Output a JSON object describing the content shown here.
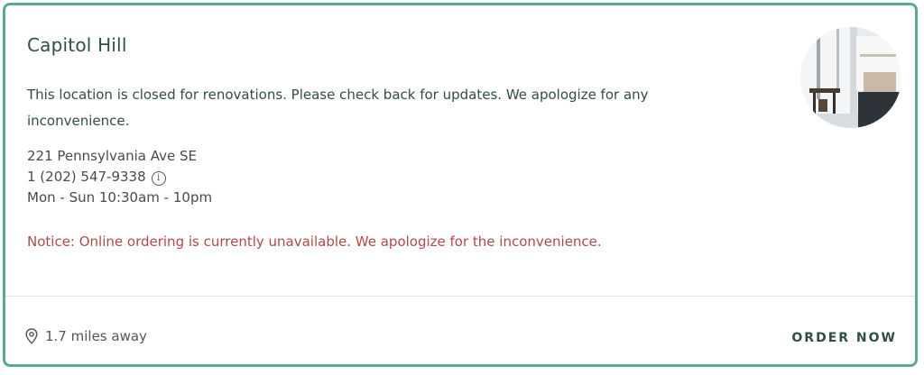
{
  "location": {
    "name": "Capitol Hill",
    "message": "This location is closed for renovations. Please check back for updates. We apologize for any inconvenience.",
    "address": "221 Pennsylvania Ave SE",
    "phone": "1 (202) 547-9338",
    "hours": "Mon - Sun 10:30am - 10pm",
    "notice": "Notice: Online ordering is currently unavailable. We apologize for the inconvenience.",
    "distance": "1.7 miles away",
    "photo_icon": "restaurant-interior-photo"
  },
  "footer": {
    "order_label": "ORDER NOW"
  },
  "colors": {
    "border": "#5aab8e",
    "title": "#2f4f46",
    "notice": "#b04a46",
    "text": "#4a4a4a"
  },
  "icons": {
    "info": "info-icon",
    "location": "location-pin-icon"
  }
}
